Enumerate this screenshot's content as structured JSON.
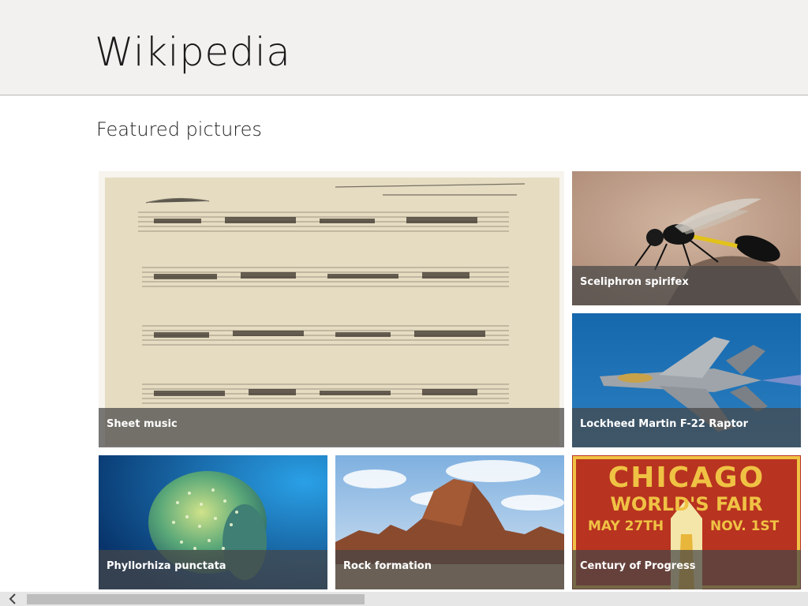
{
  "header": {
    "title": "Wikipedia"
  },
  "section": {
    "title": "Featured pictures"
  },
  "tiles": [
    {
      "caption": "Sheet music"
    },
    {
      "caption": "Sceliphron spirifex"
    },
    {
      "caption": "Lockheed Martin F-22 Raptor"
    },
    {
      "caption": "Phyllorhiza punctata"
    },
    {
      "caption": "Rock formation"
    },
    {
      "caption": "Century of Progress"
    }
  ],
  "poster": {
    "line1": "CHICAGO",
    "line2": "WORLD'S FAIR",
    "date_left": "MAY 27TH",
    "date_right": "NOV. 1ST"
  },
  "colors": {
    "header_bg": "#f2f1ef",
    "caption_bg": "rgba(70,70,70,0.72)",
    "poster_red": "#c43a22",
    "poster_yellow": "#f0c244"
  },
  "scrollbar": {
    "left_icon": "chevron-left-icon"
  }
}
